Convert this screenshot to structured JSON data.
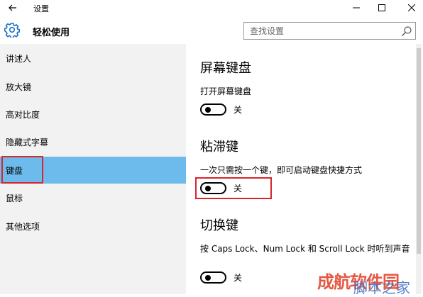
{
  "titlebar": {
    "title": "设置"
  },
  "header": {
    "title": "轻松使用"
  },
  "search": {
    "placeholder": "查找设置"
  },
  "sidebar": {
    "items": [
      {
        "label": "讲述人"
      },
      {
        "label": "放大镜"
      },
      {
        "label": "高对比度"
      },
      {
        "label": "隐藏式字幕"
      },
      {
        "label": "键盘",
        "active": true
      },
      {
        "label": "鼠标"
      },
      {
        "label": "其他选项"
      }
    ]
  },
  "main": {
    "sections": [
      {
        "title": "屏幕键盘",
        "desc": "打开屏幕键盘",
        "toggle": "关"
      },
      {
        "title": "粘滞键",
        "desc": "一次只需按一个键，即可启动键盘快捷方式",
        "toggle": "关"
      },
      {
        "title": "切换键",
        "desc": "按 Caps Lock、Num Lock 和 Scroll Lock 时听到声音",
        "toggle": "关"
      }
    ]
  },
  "colors": {
    "active_bg": "#6dbbec",
    "highlight_border": "#d9252c",
    "sidebar_bg": "#f2f2f2"
  },
  "icons": {
    "back": "arrow-left-icon",
    "header": "gear-icon",
    "search": "magnifier-icon"
  },
  "watermark": {
    "text1": "成航软件园",
    "text2": "脚本之家"
  }
}
